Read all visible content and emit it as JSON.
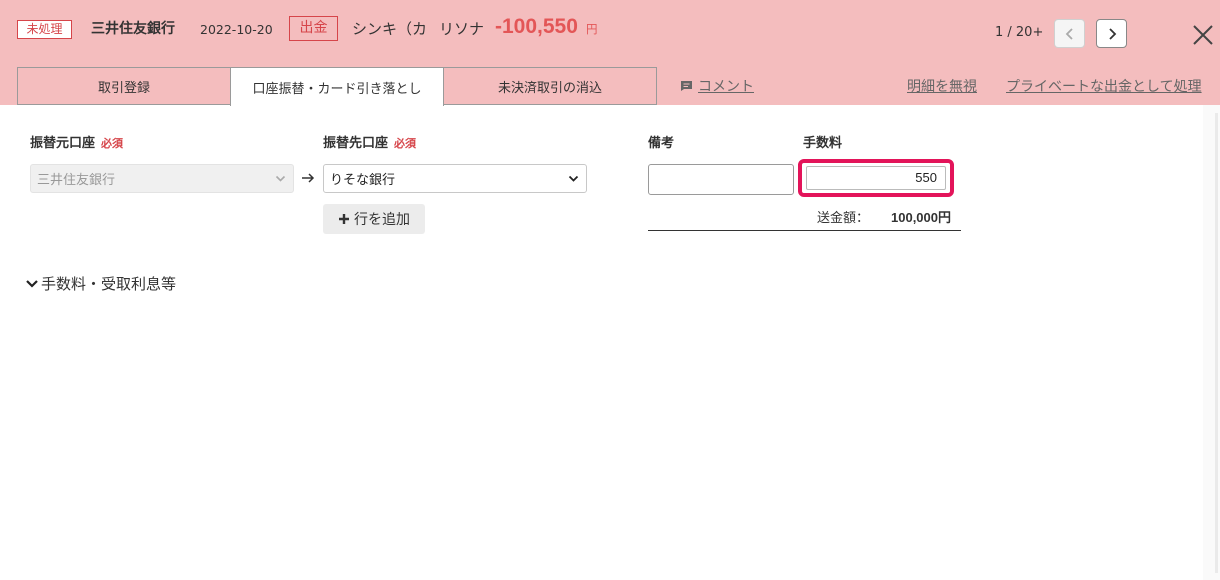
{
  "header": {
    "status": "未処理",
    "bank": "三井住友銀行",
    "date": "2022-10-20",
    "type": "出金",
    "payee_part1": "シンキ（カ",
    "payee_part2": "リソナ",
    "amount": "-100,550",
    "amount_unit": "円",
    "pager": "1 / 20+"
  },
  "tabs": [
    {
      "label": "取引登録"
    },
    {
      "label": "口座振替・カード引き落とし"
    },
    {
      "label": "未決済取引の消込"
    }
  ],
  "links": {
    "comment": "コメント",
    "ignore": "明細を無視",
    "private": "プライベートな出金として処理"
  },
  "form": {
    "from_label": "振替元口座",
    "to_label": "振替先口座",
    "required": "必須",
    "from_value": "三井住友銀行",
    "to_value": "りそな銀行",
    "add_row": "行を追加",
    "note_label": "備考",
    "note_value": "",
    "fee_label": "手数料",
    "fee_value": "550",
    "send_label": "送金額：",
    "send_value": "100,000円"
  },
  "fee_section": "手数料・受取利息等",
  "colors": {
    "header_bg": "#f4bdbe",
    "accent_red": "#e35657",
    "highlight": "#e3145a"
  },
  "icons": {
    "prev": "chevron-left-icon",
    "next": "chevron-right-icon",
    "close": "close-icon",
    "comment": "comment-icon",
    "add": "plus-icon",
    "arrow": "arrow-right-icon",
    "expand": "chevron-down-icon"
  }
}
